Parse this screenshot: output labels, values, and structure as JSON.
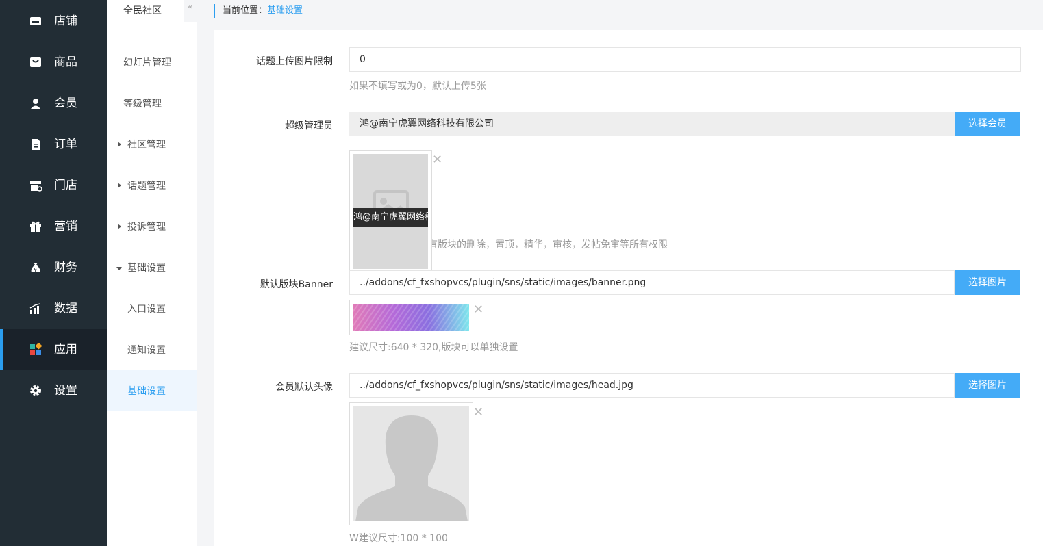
{
  "main_nav": [
    {
      "label": "店铺",
      "icon": "store-icon"
    },
    {
      "label": "商品",
      "icon": "goods-icon"
    },
    {
      "label": "会员",
      "icon": "member-icon"
    },
    {
      "label": "订单",
      "icon": "order-icon"
    },
    {
      "label": "门店",
      "icon": "shop-icon"
    },
    {
      "label": "营销",
      "icon": "gift-icon"
    },
    {
      "label": "财务",
      "icon": "money-bag-icon"
    },
    {
      "label": "数据",
      "icon": "chart-icon"
    },
    {
      "label": "应用",
      "icon": "apps-icon",
      "active": true
    },
    {
      "label": "设置",
      "icon": "gear-icon"
    }
  ],
  "sub_nav": {
    "title": "全民社区",
    "collapse_icon": "«",
    "items": [
      {
        "label": "幻灯片管理"
      },
      {
        "label": "等级管理"
      },
      {
        "label": "社区管理",
        "arrow": "right"
      },
      {
        "label": "话题管理",
        "arrow": "right"
      },
      {
        "label": "投诉管理",
        "arrow": "right"
      },
      {
        "label": "基础设置",
        "arrow": "down"
      },
      {
        "label": "入口设置"
      },
      {
        "label": "通知设置"
      },
      {
        "label": "基础设置",
        "active": true
      }
    ]
  },
  "breadcrumb": {
    "prefix": "当前位置：",
    "current": "基础设置"
  },
  "form": {
    "upload_limit": {
      "label": "话题上传图片限制",
      "value": "0",
      "help": "如果不填写或为0，默认上传5张"
    },
    "super_admin": {
      "label": "超级管理员",
      "value": "鸿@南宁虎翼网络科技有限公司",
      "button": "选择会员",
      "thumb_caption": "鸿@南宁虎翼网络科技有限公司",
      "help_visible": "有版块的删除，置顶，精华，审核，发帖免审等所有权限"
    },
    "banner": {
      "label": "默认版块Banner",
      "value": "../addons/cf_fxshopvcs/plugin/sns/static/images/banner.png",
      "button": "选择图片",
      "help": "建议尺寸:640 * 320,版块可以单独设置"
    },
    "avatar": {
      "label": "会员默认头像",
      "value": "../addons/cf_fxshopvcs/plugin/sns/static/images/head.jpg",
      "button": "选择图片",
      "help": "W建议尺寸:100 * 100"
    },
    "delete_symbol": "✕"
  },
  "colors": {
    "sidebar": "#222d35",
    "accent": "#2b9ef0",
    "button": "#44abf7"
  }
}
